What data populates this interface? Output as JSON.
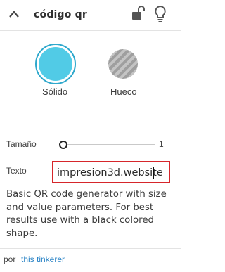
{
  "header": {
    "title": "código qr",
    "collapse_icon": "chevron-up-icon",
    "lock_icon": "unlock-icon",
    "hint_icon": "lightbulb-icon"
  },
  "shape_options": [
    {
      "label": "Sólido",
      "selected": true,
      "color": "#51cbe6"
    },
    {
      "label": "Hueco",
      "selected": false
    }
  ],
  "params": {
    "size_label": "Tamaño",
    "size_value": "1",
    "size_fraction": 0.0,
    "text_label": "Texto",
    "text_value": "impresion3d.website"
  },
  "description": "Basic QR code generator with size and value parameters. For best results use with a black colored shape.",
  "footer": {
    "by": "por",
    "author": "this tinkerer"
  },
  "colors": {
    "accent_ring": "#2fa8cc",
    "highlight_border": "#d6262b",
    "link": "#2b84c6"
  }
}
